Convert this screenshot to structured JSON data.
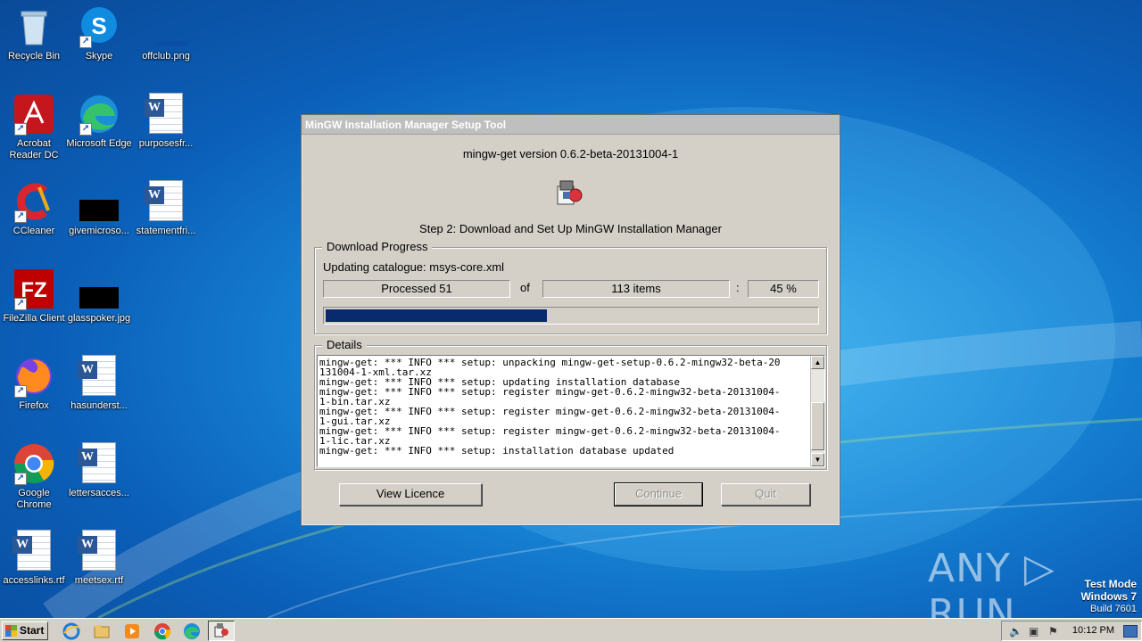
{
  "desktop": {
    "icons": [
      {
        "label": "Recycle Bin"
      },
      {
        "label": "Skype"
      },
      {
        "label": "offclub.png"
      },
      {
        "label": "Acrobat Reader DC"
      },
      {
        "label": "Microsoft Edge"
      },
      {
        "label": "purposesfr..."
      },
      {
        "label": "CCleaner"
      },
      {
        "label": "givemicroso..."
      },
      {
        "label": "statementfri..."
      },
      {
        "label": "FileZilla Client"
      },
      {
        "label": "glasspoker.jpg"
      },
      {
        "label": "Firefox"
      },
      {
        "label": "hasunderst..."
      },
      {
        "label": "Google Chrome"
      },
      {
        "label": "lettersacces..."
      },
      {
        "label": "accesslinks.rtf"
      },
      {
        "label": "meetsex.rtf"
      }
    ]
  },
  "dialog": {
    "title": "MinGW Installation Manager Setup Tool",
    "version": "mingw-get version 0.6.2-beta-20131004-1",
    "step": "Step 2: Download and Set Up MinGW Installation Manager",
    "download": {
      "legend": "Download Progress",
      "catalogue": "Updating catalogue: msys-core.xml",
      "processed": "Processed 51",
      "of": "of",
      "items": "113 items",
      "colon": ":",
      "percent": "45 %",
      "progress_fraction": 0.45
    },
    "details": {
      "legend": "Details",
      "log": "mingw-get: *** INFO *** setup: unpacking mingw-get-setup-0.6.2-mingw32-beta-20\n131004-1-xml.tar.xz\nmingw-get: *** INFO *** setup: updating installation database\nmingw-get: *** INFO *** setup: register mingw-get-0.6.2-mingw32-beta-20131004-\n1-bin.tar.xz\nmingw-get: *** INFO *** setup: register mingw-get-0.6.2-mingw32-beta-20131004-\n1-gui.tar.xz\nmingw-get: *** INFO *** setup: register mingw-get-0.6.2-mingw32-beta-20131004-\n1-lic.tar.xz\nmingw-get: *** INFO *** setup: installation database updated"
    },
    "buttons": {
      "view_licence": "View Licence",
      "continue": "Continue",
      "quit": "Quit"
    }
  },
  "watermark": {
    "brand": "ANY ▷ RUN",
    "test_mode": "Test Mode",
    "os": "Windows 7",
    "build": "Build 7601"
  },
  "taskbar": {
    "start": "Start",
    "clock": "10:12 PM"
  }
}
